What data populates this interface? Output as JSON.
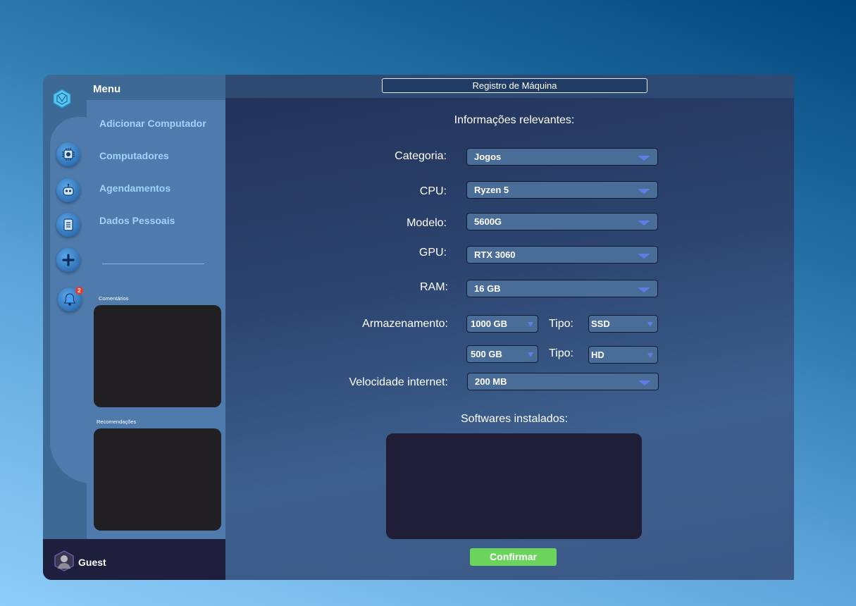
{
  "sidebar": {
    "menu_title": "Menu",
    "items": [
      {
        "label": "Adicionar Computador"
      },
      {
        "label": "Computadores"
      },
      {
        "label": "Agendamentos"
      },
      {
        "label": "Dados Pessoais"
      }
    ],
    "rail_icons": [
      "logo-icon",
      "computer-chip-icon",
      "robot-icon",
      "checklist-icon",
      "add-icon",
      "notification-bell-icon"
    ],
    "notification_count": "2",
    "comments_label": "Comentários",
    "recommendations_label": "Recomendações"
  },
  "user": {
    "name": "Guest"
  },
  "header": {
    "title": "Registro de Máquina"
  },
  "form": {
    "relevant_info_title": "Informações relevantes:",
    "categoria": {
      "label": "Categoria:",
      "value": "Jogos"
    },
    "cpu": {
      "label": "CPU:",
      "value": "Ryzen 5"
    },
    "modelo": {
      "label": "Modelo:",
      "value": "5600G"
    },
    "gpu": {
      "label": "GPU:",
      "value": "RTX 3060"
    },
    "ram": {
      "label": "RAM:",
      "value": "16 GB"
    },
    "armazenamento": {
      "label": "Armazenamento:",
      "tipo_label": "Tipo:",
      "rows": [
        {
          "size": "1000 GB",
          "tipo": "SSD"
        },
        {
          "size": "500 GB",
          "tipo": "HD"
        }
      ]
    },
    "internet": {
      "label": "Velocidade internet:",
      "value": "200 MB"
    },
    "software_title": "Softwares instalados:",
    "confirm_label": "Confirmar"
  },
  "colors": {
    "accent": "#6bd45d",
    "menu_link": "#9fd2ff",
    "caret": "#5e7de8"
  }
}
